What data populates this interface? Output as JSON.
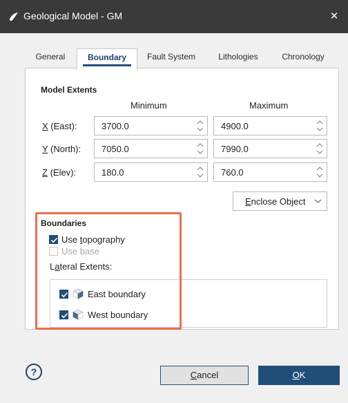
{
  "window": {
    "title": "Geological Model - GM",
    "close_glyph": "✕"
  },
  "tabs": [
    {
      "label": "General"
    },
    {
      "label": "Boundary"
    },
    {
      "label": "Fault System"
    },
    {
      "label": "Lithologies"
    },
    {
      "label": "Chronology"
    }
  ],
  "active_tab": "Boundary",
  "model_extents": {
    "title": "Model Extents",
    "col_min": "Minimum",
    "col_max": "Maximum",
    "rows": [
      {
        "key": "X",
        "rest": " (East):",
        "min": "3700.0",
        "max": "4900.0"
      },
      {
        "key": "Y",
        "rest": " (North):",
        "min": "7050.0",
        "max": "7990.0"
      },
      {
        "key": "Z",
        "rest": " (Elev):",
        "min": "180.0",
        "max": "760.0"
      }
    ],
    "enclose_key": "E",
    "enclose_rest": "nclose Object"
  },
  "boundaries": {
    "title": "Boundaries",
    "use_topography_pre": "Use ",
    "use_topography_key": "t",
    "use_topography_post": "opography",
    "use_topography_checked": true,
    "use_base": "Use base",
    "use_base_checked": false,
    "lateral_pre": "L",
    "lateral_key": "a",
    "lateral_post": "teral Extents:",
    "items": [
      {
        "label": "East boundary",
        "checked": true
      },
      {
        "label": "West boundary",
        "checked": true
      }
    ]
  },
  "footer": {
    "help_glyph": "?",
    "cancel_key": "C",
    "cancel_rest": "ancel",
    "ok_key": "O",
    "ok_rest": "K"
  },
  "colors": {
    "accent": "#1f4e79",
    "highlight": "#ee6d4d",
    "titlebar": "#3a3a3a"
  }
}
